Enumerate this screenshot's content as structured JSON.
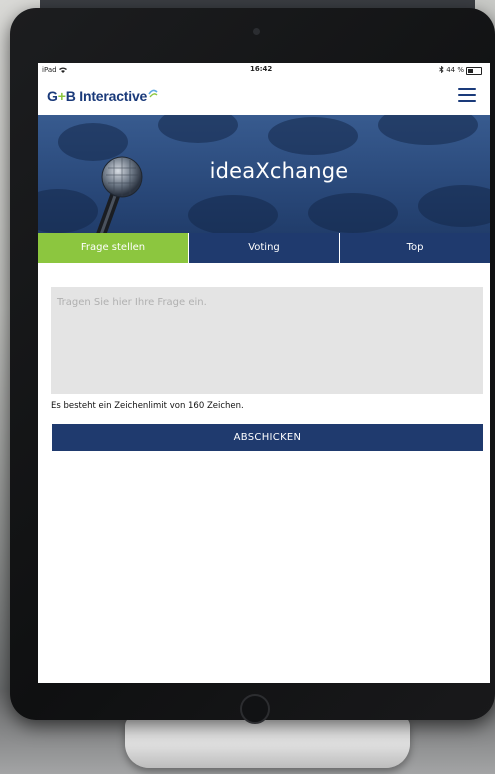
{
  "status_bar": {
    "carrier": "iPad",
    "time": "16:42",
    "battery_text": "44 %",
    "battery_level": 0.44
  },
  "header": {
    "logo_left": "G",
    "logo_plus": "+",
    "logo_b": "B",
    "logo_word": " Interactive",
    "menu_icon": "hamburger-menu-icon"
  },
  "banner": {
    "title": "ideaXchange",
    "image": "microphone-icon"
  },
  "tabs": [
    {
      "label": "Frage stellen",
      "active": true
    },
    {
      "label": "Voting",
      "active": false
    },
    {
      "label": "Top",
      "active": false
    }
  ],
  "form": {
    "question_placeholder": "Tragen Sie hier Ihre Frage ein.",
    "question_value": "",
    "char_limit_text": "Es besteht ein Zeichenlimit von 160 Zeichen.",
    "submit_label": "ABSCHICKEN"
  },
  "colors": {
    "brand_navy": "#1f3a6e",
    "accent_green": "#8cc63f",
    "input_bg": "#e4e4e4"
  }
}
